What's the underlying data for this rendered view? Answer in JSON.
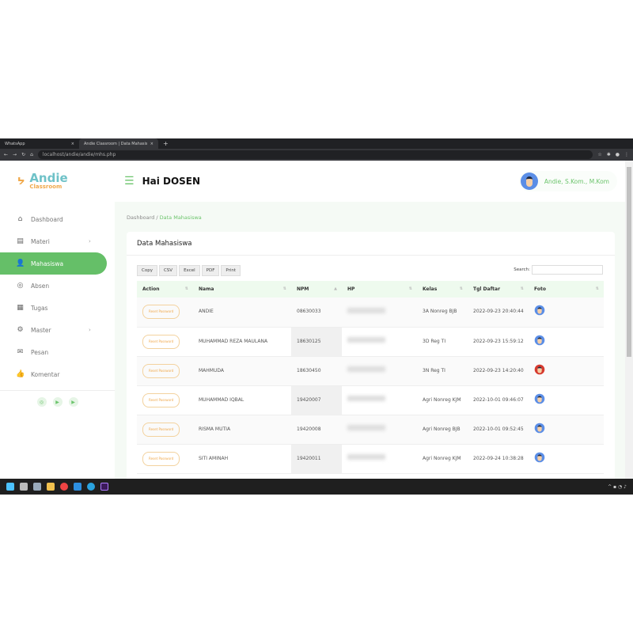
{
  "browser": {
    "tabs": [
      {
        "label": "WhatsApp"
      },
      {
        "label": "Andie Classroom | Data Mahasiswa"
      }
    ],
    "url": "localhost/andie/andie/mhs.php"
  },
  "brand": {
    "name": "Andie",
    "sub": "Classroom"
  },
  "header": {
    "greeting": "Hai DOSEN",
    "user": "Andie, S.Kom., M.Kom"
  },
  "sidebar": {
    "items": [
      {
        "label": "Dashboard",
        "icon": "⌂"
      },
      {
        "label": "Materi",
        "icon": "▤",
        "chev": "›"
      },
      {
        "label": "Mahasiswa",
        "icon": "👤"
      },
      {
        "label": "Absen",
        "icon": "◎"
      },
      {
        "label": "Tugas",
        "icon": "▦"
      },
      {
        "label": "Master",
        "icon": "⚙",
        "chev": "›"
      },
      {
        "label": "Pesan",
        "icon": "✉"
      },
      {
        "label": "Komentar",
        "icon": "👍"
      }
    ],
    "social": [
      "◎",
      "▶",
      "▶"
    ]
  },
  "breadcrumb": {
    "home": "Dashboard",
    "sep": "/",
    "current": "Data Mahasiswa"
  },
  "card": {
    "title": "Data Mahasiswa"
  },
  "toolbar": [
    "Copy",
    "CSV",
    "Excel",
    "PDF",
    "Print"
  ],
  "search": {
    "label": "Search:",
    "value": ""
  },
  "table": {
    "columns": [
      "Action",
      "Nama",
      "NPM",
      "HP",
      "Kelas",
      "Tgl Daftar",
      "Foto"
    ],
    "action_label": "Reset Password",
    "rows": [
      {
        "nama": "ANDIE",
        "npm": "08630033",
        "kelas": "3A Nonreg BJB",
        "tgl": "2022-09-23 20:40:44",
        "foto": "blue"
      },
      {
        "nama": "MUHAMMAD REZA MAULANA",
        "npm": "18630125",
        "kelas": "3D Reg TI",
        "tgl": "2022-09-23 15:59:12",
        "foto": "blue"
      },
      {
        "nama": "MAHMUDA",
        "npm": "18630450",
        "kelas": "3N Reg TI",
        "tgl": "2022-09-23 14:20:40",
        "foto": "red"
      },
      {
        "nama": "MUHAMMAD IQBAL",
        "npm": "19420007",
        "kelas": "Agri Nonreg KJM",
        "tgl": "2022-10-01 09:46:07",
        "foto": "blue"
      },
      {
        "nama": "RISMA MUTIA",
        "npm": "19420008",
        "kelas": "Agri Nonreg BJB",
        "tgl": "2022-10-01 09:52:45",
        "foto": "blue"
      },
      {
        "nama": "SITI AMINAH",
        "npm": "19420011",
        "kelas": "Agri Nonreg KJM",
        "tgl": "2022-09-24 10:38:28",
        "foto": "blue"
      }
    ]
  },
  "colors": {
    "accent": "#65bf68",
    "brand_teal": "#6fc2c8",
    "brand_orange": "#f0a84a"
  }
}
